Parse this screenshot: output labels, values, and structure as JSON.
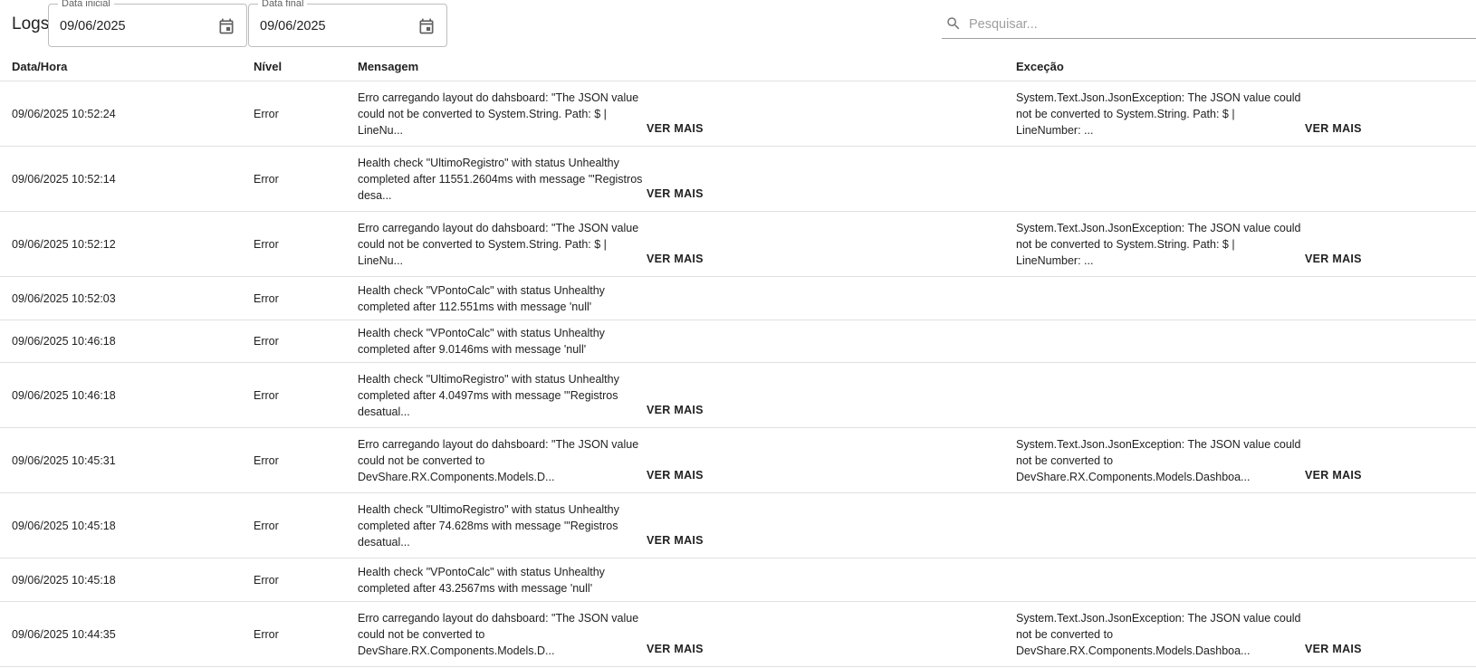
{
  "header": {
    "title": "Logs",
    "date_start": {
      "label": "Data inicial",
      "value": "09/06/2025"
    },
    "date_end": {
      "label": "Data final",
      "value": "09/06/2025"
    },
    "search": {
      "placeholder": "Pesquisar...",
      "value": ""
    }
  },
  "table": {
    "columns": [
      "Data/Hora",
      "Nível",
      "Mensagem",
      "Exceção"
    ],
    "more_label": "VER MAIS",
    "rows": [
      {
        "datetime": "09/06/2025 10:52:24",
        "level": "Error",
        "message": "Erro carregando layout do dahsboard: \"The JSON value could not be converted to System.String. Path: $ | LineNu...",
        "exception": "System.Text.Json.JsonException: The JSON value could not be converted to System.String. Path: $ | LineNumber: ...",
        "msg_more": true,
        "exc_more": true
      },
      {
        "datetime": "09/06/2025 10:52:14",
        "level": "Error",
        "message": "Health check \"UltimoRegistro\" with status Unhealthy completed after 11551.2604ms with message '\"Registros desa...",
        "exception": "",
        "msg_more": true,
        "exc_more": false
      },
      {
        "datetime": "09/06/2025 10:52:12",
        "level": "Error",
        "message": "Erro carregando layout do dahsboard: \"The JSON value could not be converted to System.String. Path: $ | LineNu...",
        "exception": "System.Text.Json.JsonException: The JSON value could not be converted to System.String. Path: $ | LineNumber: ...",
        "msg_more": true,
        "exc_more": true
      },
      {
        "datetime": "09/06/2025 10:52:03",
        "level": "Error",
        "message": "Health check \"VPontoCalc\" with status Unhealthy completed after 112.551ms with message 'null'",
        "exception": "",
        "msg_more": false,
        "exc_more": false
      },
      {
        "datetime": "09/06/2025 10:46:18",
        "level": "Error",
        "message": "Health check \"VPontoCalc\" with status Unhealthy completed after 9.0146ms with message 'null'",
        "exception": "",
        "msg_more": false,
        "exc_more": false
      },
      {
        "datetime": "09/06/2025 10:46:18",
        "level": "Error",
        "message": "Health check \"UltimoRegistro\" with status Unhealthy completed after 4.0497ms with message '\"Registros desatual...",
        "exception": "",
        "msg_more": true,
        "exc_more": false
      },
      {
        "datetime": "09/06/2025 10:45:31",
        "level": "Error",
        "message": "Erro carregando layout do dahsboard: \"The JSON value could not be converted to DevShare.RX.Components.Models.D...",
        "exception": "System.Text.Json.JsonException: The JSON value could not be converted to DevShare.RX.Components.Models.Dashboa...",
        "msg_more": true,
        "exc_more": true
      },
      {
        "datetime": "09/06/2025 10:45:18",
        "level": "Error",
        "message": "Health check \"UltimoRegistro\" with status Unhealthy completed after 74.628ms with message '\"Registros desatual...",
        "exception": "",
        "msg_more": true,
        "exc_more": false
      },
      {
        "datetime": "09/06/2025 10:45:18",
        "level": "Error",
        "message": "Health check \"VPontoCalc\" with status Unhealthy completed after 43.2567ms with message 'null'",
        "exception": "",
        "msg_more": false,
        "exc_more": false
      },
      {
        "datetime": "09/06/2025 10:44:35",
        "level": "Error",
        "message": "Erro carregando layout do dahsboard: \"The JSON value could not be converted to DevShare.RX.Components.Models.D...",
        "exception": "System.Text.Json.JsonException: The JSON value could not be converted to DevShare.RX.Components.Models.Dashboa...",
        "msg_more": true,
        "exc_more": true
      }
    ]
  },
  "icons": {
    "calendar": "calendar-icon",
    "search": "search-icon"
  },
  "colors": {
    "text": "#212121",
    "divider": "#e0e0e0",
    "placeholder": "#9e9e9e"
  }
}
